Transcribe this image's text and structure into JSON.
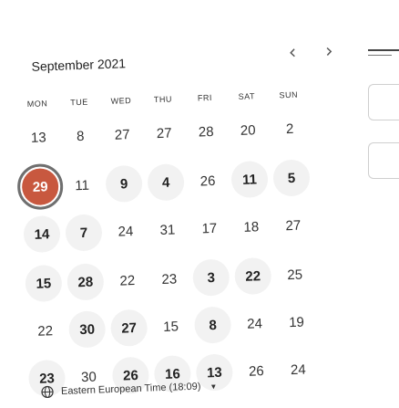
{
  "calendar": {
    "month_title": "September 2021",
    "prev_icon": "chevron-left-icon",
    "next_icon": "chevron-right-icon",
    "weekdays": [
      "MON",
      "TUE",
      "WED",
      "THU",
      "FRI",
      "SAT",
      "SUN"
    ],
    "weeks": [
      [
        {
          "d": "13",
          "s": "plain"
        },
        {
          "d": "8",
          "s": "plain"
        },
        {
          "d": "27",
          "s": "plain"
        },
        {
          "d": "27",
          "s": "plain"
        },
        {
          "d": "28",
          "s": "plain"
        },
        {
          "d": "20",
          "s": "plain"
        },
        {
          "d": "2",
          "s": "plain"
        }
      ],
      [
        {
          "d": "29",
          "s": "selected"
        },
        {
          "d": "11",
          "s": "plain"
        },
        {
          "d": "9",
          "s": "avail"
        },
        {
          "d": "4",
          "s": "avail"
        },
        {
          "d": "26",
          "s": "plain"
        },
        {
          "d": "11",
          "s": "avail"
        },
        {
          "d": "5",
          "s": "avail"
        }
      ],
      [
        {
          "d": "14",
          "s": "avail"
        },
        {
          "d": "7",
          "s": "avail"
        },
        {
          "d": "24",
          "s": "plain"
        },
        {
          "d": "31",
          "s": "plain"
        },
        {
          "d": "17",
          "s": "plain"
        },
        {
          "d": "18",
          "s": "plain"
        },
        {
          "d": "27",
          "s": "plain"
        }
      ],
      [
        {
          "d": "15",
          "s": "avail"
        },
        {
          "d": "28",
          "s": "avail"
        },
        {
          "d": "22",
          "s": "plain"
        },
        {
          "d": "23",
          "s": "plain"
        },
        {
          "d": "3",
          "s": "avail"
        },
        {
          "d": "22",
          "s": "avail"
        },
        {
          "d": "25",
          "s": "plain"
        }
      ],
      [
        {
          "d": "22",
          "s": "plain"
        },
        {
          "d": "30",
          "s": "avail"
        },
        {
          "d": "27",
          "s": "avail"
        },
        {
          "d": "15",
          "s": "plain"
        },
        {
          "d": "8",
          "s": "avail"
        },
        {
          "d": "24",
          "s": "plain"
        },
        {
          "d": "19",
          "s": "plain"
        }
      ],
      [
        {
          "d": "23",
          "s": "avail"
        },
        {
          "d": "30",
          "s": "plain"
        },
        {
          "d": "26",
          "s": "avail"
        },
        {
          "d": "16",
          "s": "avail"
        },
        {
          "d": "13",
          "s": "avail"
        },
        {
          "d": "26",
          "s": "plain"
        },
        {
          "d": "24",
          "s": "plain"
        }
      ]
    ]
  },
  "timezone": {
    "label": "Eastern European Time (18:09)",
    "icon": "globe-icon"
  },
  "colors": {
    "selected": "#c8583f",
    "available_bg": "#f2f2f2",
    "text": "#2b2b2b"
  }
}
